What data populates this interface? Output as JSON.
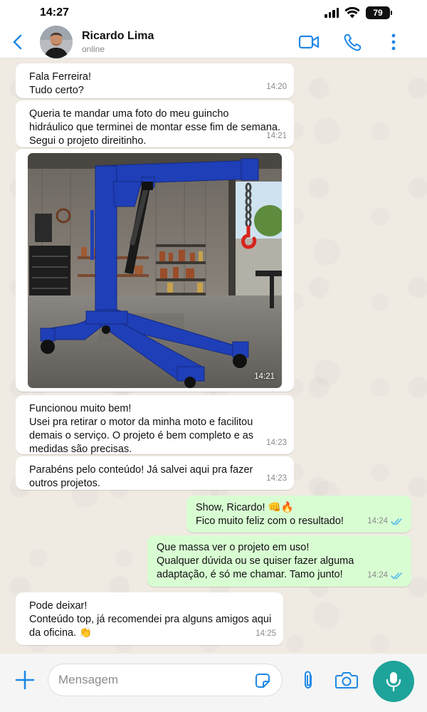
{
  "status_bar": {
    "time": "14:27",
    "battery": "79"
  },
  "header": {
    "contact_name": "Ricardo Lima",
    "contact_status": "online",
    "icons": [
      "back-arrow-icon",
      "video-call-icon",
      "phone-icon",
      "more-vertical-icon"
    ]
  },
  "colors": {
    "accent": "#1e88e5",
    "incoming_bubble": "#ffffff",
    "outgoing_bubble": "#d9fdd3",
    "read_ticks": "#53bdeb",
    "mic_button": "#1ea39a",
    "chat_background": "#efeae2",
    "crane_blue": "#1f3fb8"
  },
  "messages": [
    {
      "direction": "incoming",
      "text": "Fala Ferreira!\nTudo certo?",
      "time": "14:20"
    },
    {
      "direction": "incoming",
      "text": "Queria te mandar uma foto do meu guincho\nhidráulico que terminei de montar esse fim de semana.\nSegui o projeto direitinho.",
      "time": "14:21"
    },
    {
      "direction": "incoming",
      "type": "image",
      "image": "blue-hydraulic-engine-crane-in-garage",
      "time": "14:21"
    },
    {
      "direction": "incoming",
      "text": "Funcionou muito bem!\nUsei pra retirar o motor da minha moto e facilitou\ndemais o serviço. O projeto é bem completo e as\nmedidas são precisas.",
      "time": "14:23"
    },
    {
      "direction": "incoming",
      "text": "Parabéns pelo conteúdo! Já salvei aqui pra fazer\noutros projetos.",
      "time": "14:23"
    },
    {
      "direction": "outgoing",
      "text": "Show, Ricardo! 👊🔥\nFico muito feliz com o resultado!",
      "time": "14:24",
      "status": "read"
    },
    {
      "direction": "outgoing",
      "text": "Que massa ver o projeto em uso!\nQualquer dúvida ou se quiser fazer alguma\nadaptação, é só me chamar. Tamo junto!",
      "time": "14:24",
      "status": "read"
    },
    {
      "direction": "incoming",
      "text": "Pode deixar!\nConteúdo top, já recomendei pra alguns amigos aqui\nda oficina. 👏",
      "time": "14:25"
    }
  ],
  "input_bar": {
    "placeholder": "Mensagem",
    "icons": [
      "plus-icon",
      "sticker-icon",
      "paperclip-icon",
      "camera-icon",
      "microphone-icon"
    ]
  }
}
